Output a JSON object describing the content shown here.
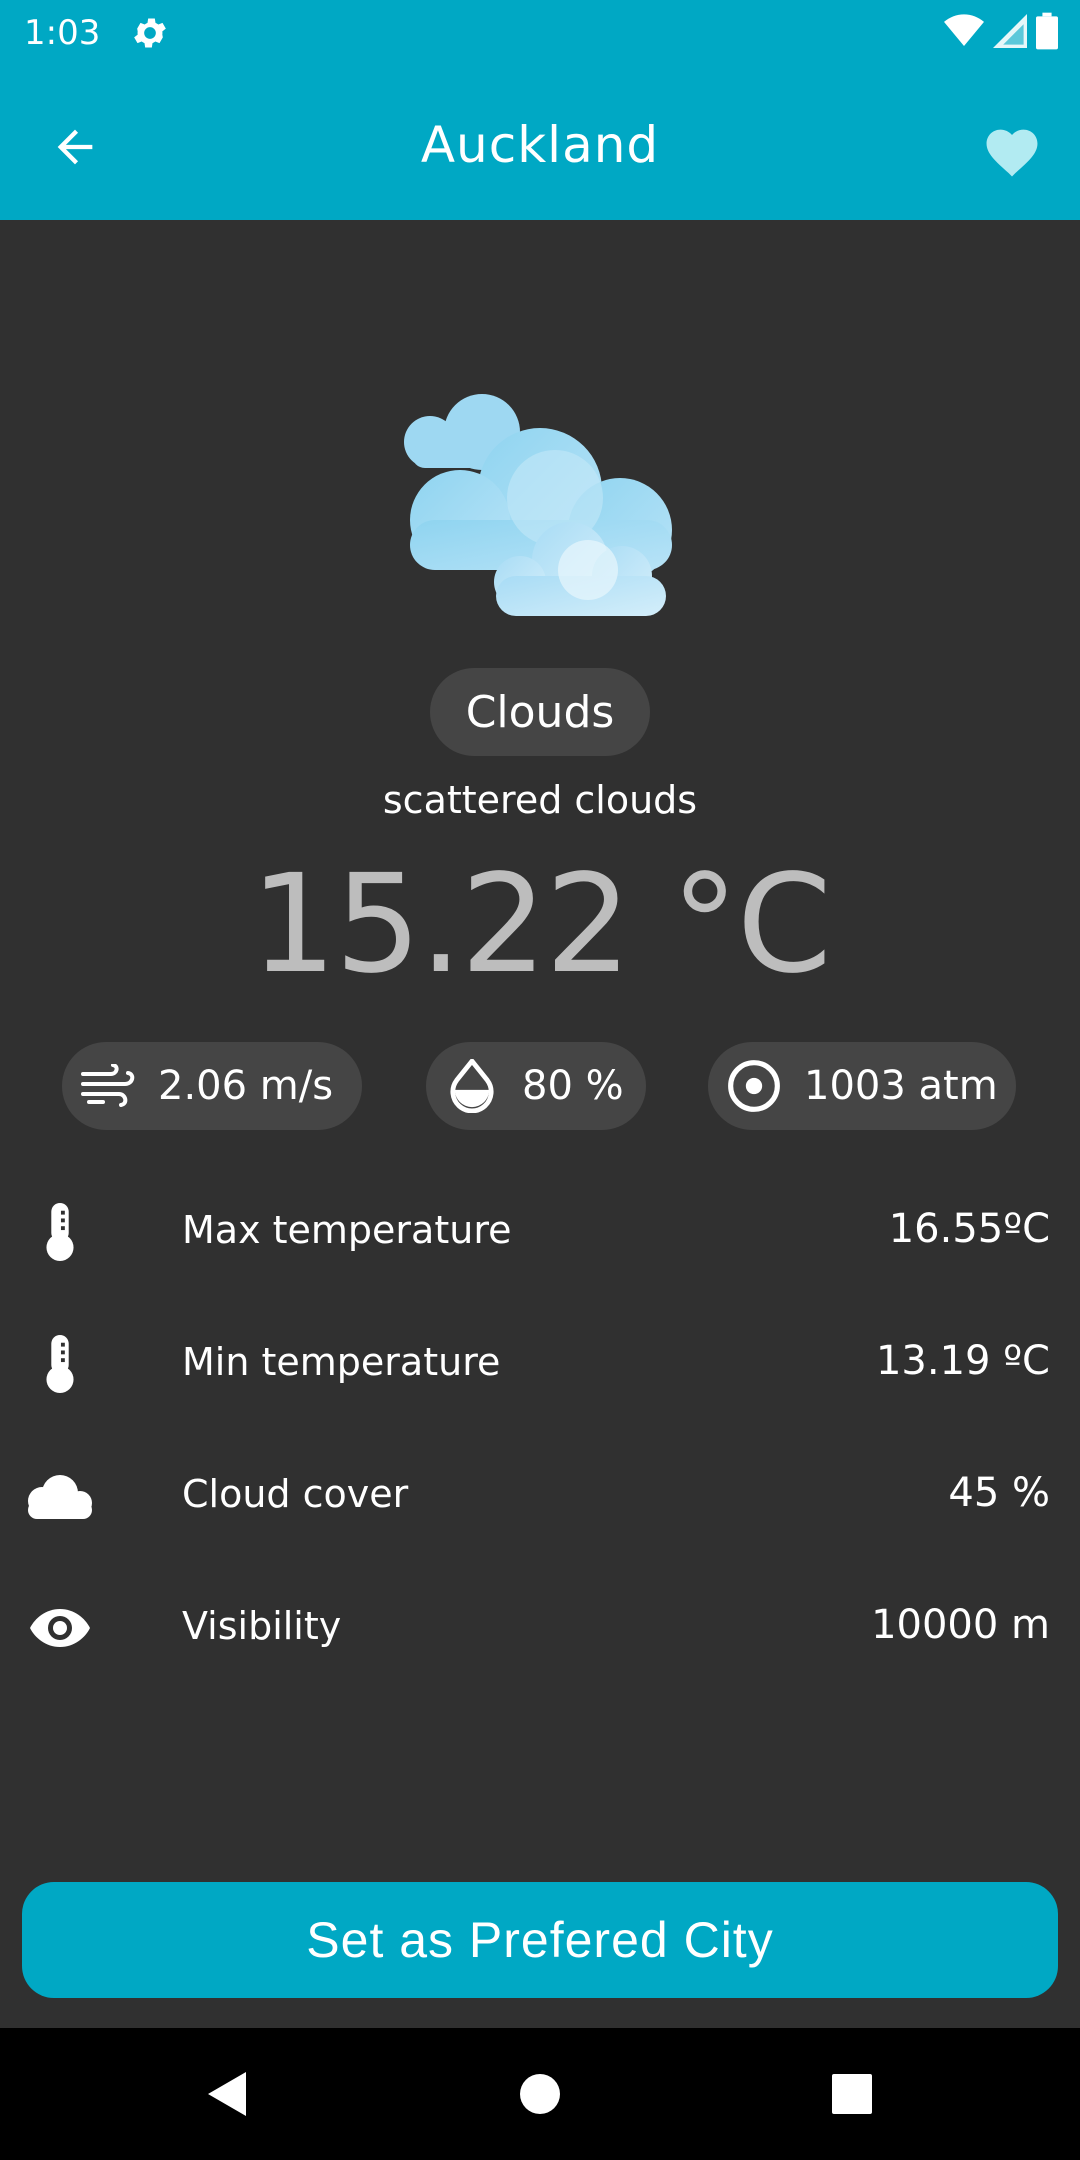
{
  "status_bar": {
    "time": "1:03"
  },
  "app_bar": {
    "title": "Auckland"
  },
  "weather": {
    "main": "Clouds",
    "description": "scattered clouds",
    "temperature": "15.22 °C",
    "icon": "scattered-clouds-icon"
  },
  "stats": {
    "wind": "2.06 m/s",
    "humidity": "80 %",
    "pressure": "1003 atm"
  },
  "details": [
    {
      "label": "Max temperature",
      "value": "16.55ºC",
      "icon": "thermometer-icon"
    },
    {
      "label": "Min temperature",
      "value": "13.19 ºC",
      "icon": "thermometer-icon"
    },
    {
      "label": "Cloud cover",
      "value": "45 %",
      "icon": "cloud-icon"
    },
    {
      "label": "Visibility",
      "value": "10000 m",
      "icon": "eye-icon"
    }
  ],
  "actions": {
    "set_preferred": "Set as Prefered City"
  },
  "colors": {
    "accent": "#00A8C4",
    "background": "#303030",
    "chip": "#454545",
    "favorite": "#B2EBF2"
  }
}
